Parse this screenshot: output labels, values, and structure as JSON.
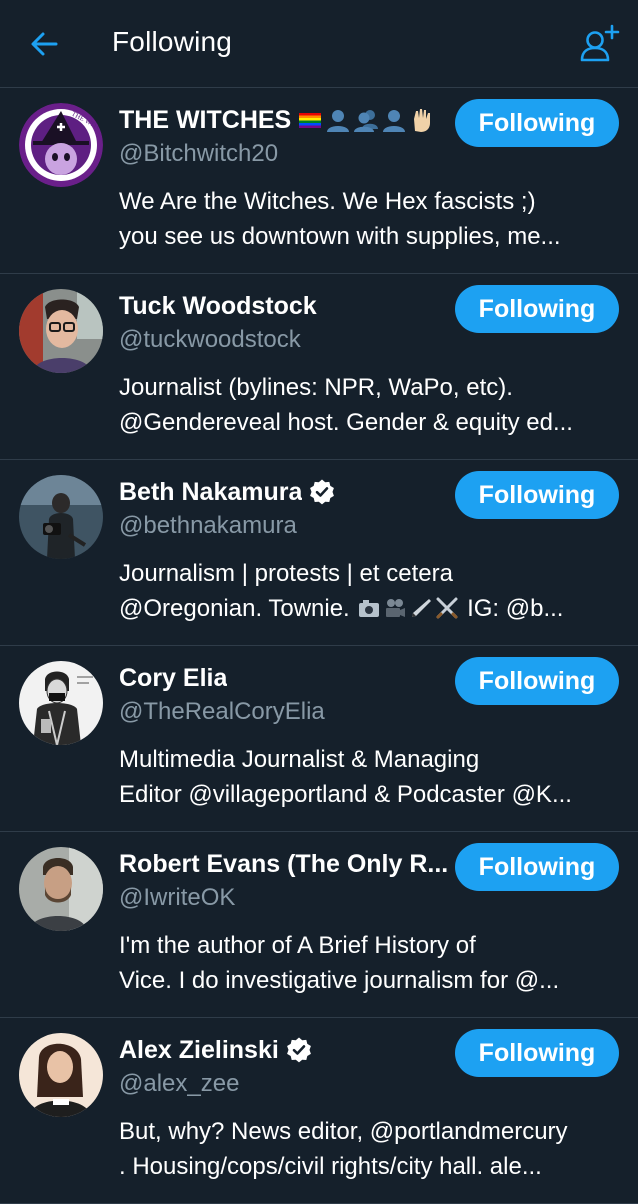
{
  "header": {
    "title": "Following",
    "back_icon": "arrow-left-icon",
    "add_icon": "add-user-icon",
    "accent_color": "#1da1f2"
  },
  "follow_label": "Following",
  "users": [
    {
      "name": "THE WITCHES",
      "name_emojis": [
        "rainbow-flag",
        "bust-silhouette",
        "busts-silhouette",
        "bust-silhouette",
        "raised-hand"
      ],
      "handle": "@Bitchwitch20",
      "bio_line1": "We Are the Witches. We Hex fascists ;)",
      "bio_line2": "you see us downtown with supplies, me...",
      "avatar_text_top": "THE WITCHES",
      "avatar_text_sub": "WE HEX FASCISTS",
      "verified": false
    },
    {
      "name": "Tuck Woodstock",
      "handle": "@tuckwoodstock",
      "bio_line1": "Journalist (bylines: NPR, WaPo, etc).",
      "bio_line2": "@Gendereveal host. Gender & equity ed...",
      "verified": false
    },
    {
      "name": "Beth Nakamura",
      "handle": "@bethnakamura",
      "bio_line1": "Journalism | protests | et cetera",
      "bio_line2_a": "@Oregonian. Townie.",
      "bio_line2_b": "IG: @b...",
      "bio_emojis": [
        "camera-flash",
        "movie-camera",
        "pen",
        "crossed-swords"
      ],
      "verified": true
    },
    {
      "name": "Cory Elia",
      "handle": "@TheRealCoryElia",
      "bio_line1": "Multimedia Journalist & Managing",
      "bio_line2": "Editor @villageportland & Podcaster @K...",
      "verified": false
    },
    {
      "name": "Robert Evans (The Only R...",
      "handle": "@IwriteOK",
      "bio_line1": "I'm the author of A Brief History of",
      "bio_line2": "Vice. I do investigative journalism for @...",
      "verified": false
    },
    {
      "name": "Alex Zielinski",
      "handle": "@alex_zee",
      "bio_line1": "But, why? News editor, @portlandmercury",
      "bio_line2": ". Housing/cops/civil rights/city hall. ale...",
      "verified": true
    }
  ]
}
